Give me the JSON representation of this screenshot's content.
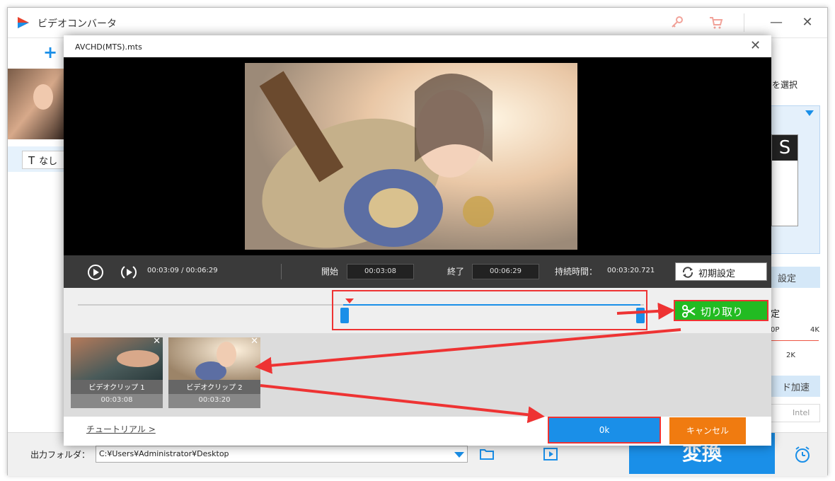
{
  "app": {
    "title": "ビデオコンバータ",
    "toolbar_plus": "+",
    "minimize": "—",
    "maximize": "☐",
    "close": "✕"
  },
  "subtitle": {
    "value": "なし",
    "icon": "text-icon"
  },
  "right_panel": {
    "select_label": "を選択",
    "format_big": "S",
    "settings_label": "設定",
    "quality_label": "定",
    "scale_low": "0P",
    "scale_high": "4K",
    "scale_mid": "2K",
    "accel_label": "ド加速",
    "intel_label": "Intel"
  },
  "bottom": {
    "output_label": "出力フォルダ：",
    "output_path": "C:¥Users¥Administrator¥Desktop",
    "convert_label": "変換"
  },
  "dialog": {
    "title": "AVCHD(MTS).mts",
    "close": "✕",
    "time_display": "00:03:09  /  00:06:29",
    "start_label": "開始",
    "start_value": "00:03:08",
    "end_label": "終了",
    "end_value": "00:06:29",
    "duration_label": "持続時間：",
    "duration_value": "00:03:20.721",
    "reset_label": "初期設定",
    "cut_label": "切り取り",
    "clips": [
      {
        "name": "ビデオクリップ 1",
        "time": "00:03:08"
      },
      {
        "name": "ビデオクリップ 2",
        "time": "00:03:20"
      }
    ],
    "tutorial_label": "チュートリアル >",
    "ok_label": "0k",
    "cancel_label": "キャンセル"
  },
  "colors": {
    "accent": "#1a8fe8",
    "cut_green": "#22bb22",
    "cancel_orange": "#f07b10",
    "highlight_red": "#e33333"
  }
}
